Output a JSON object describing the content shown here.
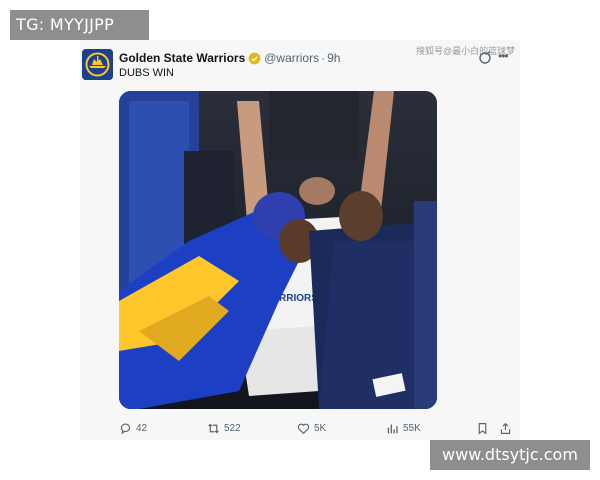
{
  "overlays": {
    "top_left_tag": "TG: MYYJJPP",
    "bottom_right_site": "www.dtsytjc.com",
    "cn_watermark": "搜狐号@最小白的篮球梦"
  },
  "tweet": {
    "display_name": "Golden State Warriors",
    "handle": "@warriors",
    "separator": "·",
    "time": "9h",
    "text": "DUBS WIN",
    "verified_icon": "gold-verified-badge",
    "avatar_icon": "warriors-logo"
  },
  "actions": {
    "replies": "42",
    "retweets": "522",
    "likes": "5K",
    "views": "55K"
  },
  "colors": {
    "warriors_blue": "#1d428a",
    "warriors_gold": "#ffc72c",
    "verified_gold": "#e2b719",
    "muted_text": "#536471",
    "overlay_gray": "#8e8e8e"
  }
}
